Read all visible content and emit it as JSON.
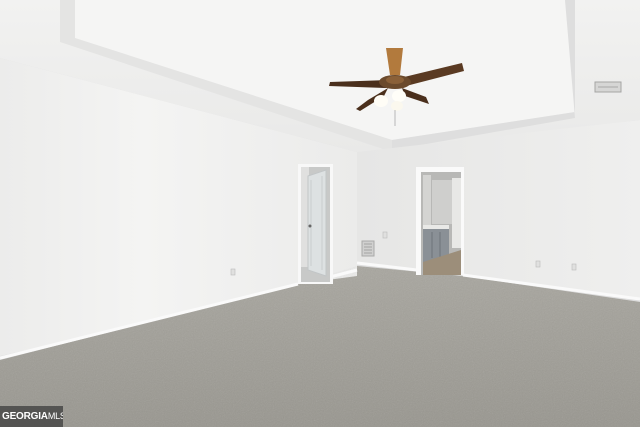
{
  "watermark": {
    "brand": "GEORGIA",
    "suffix": "MLS"
  },
  "colors": {
    "wall_left": "#f1f1f0",
    "wall_back": "#ebebea",
    "ceiling": "#f4f4f3",
    "carpet": "#a19f99",
    "door": "#dfe2e3",
    "fan_blade": "#5a3a22"
  }
}
